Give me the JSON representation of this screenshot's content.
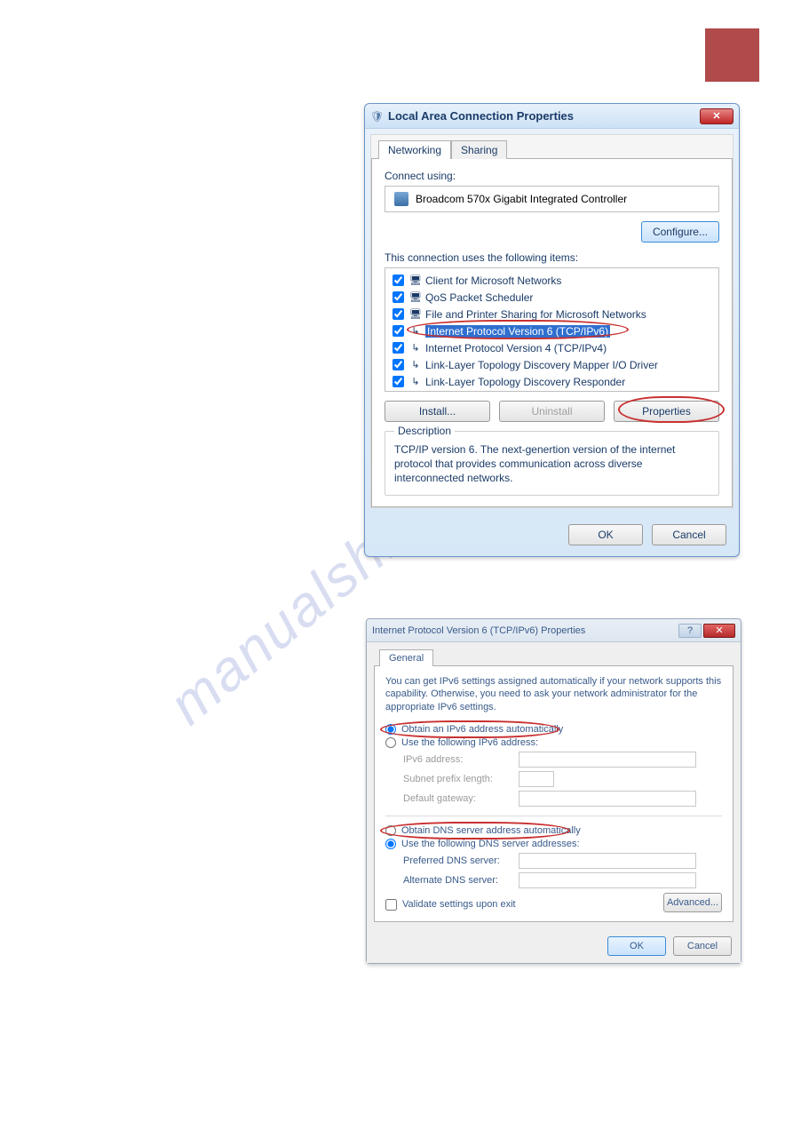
{
  "watermark": "manualshive.com",
  "dialog1": {
    "title": "Local Area Connection Properties",
    "tabs": {
      "networking": "Networking",
      "sharing": "Sharing"
    },
    "connect_using_label": "Connect using:",
    "adapter": "Broadcom 570x Gigabit Integrated Controller",
    "configure_btn": "Configure...",
    "items_label": "This connection uses the following items:",
    "items": [
      {
        "label": "Client for Microsoft Networks",
        "icon": "🖥"
      },
      {
        "label": "QoS Packet Scheduler",
        "icon": "🖥"
      },
      {
        "label": "File and Printer Sharing for Microsoft Networks",
        "icon": "🖥"
      },
      {
        "label": "Internet Protocol Version 6 (TCP/IPv6)",
        "icon": "↳",
        "selected": true
      },
      {
        "label": "Internet Protocol Version 4 (TCP/IPv4)",
        "icon": "↳"
      },
      {
        "label": "Link-Layer Topology Discovery Mapper I/O Driver",
        "icon": "↳"
      },
      {
        "label": "Link-Layer Topology Discovery Responder",
        "icon": "↳"
      }
    ],
    "install_btn": "Install...",
    "uninstall_btn": "Uninstall",
    "properties_btn": "Properties",
    "description_legend": "Description",
    "description_text": "TCP/IP version 6. The next-genertion version of the internet protocol that provides communication across diverse interconnected networks.",
    "ok_btn": "OK",
    "cancel_btn": "Cancel"
  },
  "dialog2": {
    "title": "Internet Protocol Version 6 (TCP/IPv6) Properties",
    "tab_general": "General",
    "intro": "You can get IPv6 settings assigned automatically if your network supports this capability. Otherwise, you need to ask your network administrator for the appropriate IPv6 settings.",
    "radio_auto_ip": "Obtain an IPv6 address automatically",
    "radio_manual_ip": "Use the following IPv6 address:",
    "lbl_ipv6_addr": "IPv6 address:",
    "lbl_prefix": "Subnet prefix length:",
    "lbl_gateway": "Default gateway:",
    "radio_auto_dns": "Obtain DNS server address automatically",
    "radio_manual_dns": "Use the following DNS server addresses:",
    "lbl_pref_dns": "Preferred DNS server:",
    "lbl_alt_dns": "Alternate DNS server:",
    "chk_validate": "Validate settings upon exit",
    "advanced_btn": "Advanced...",
    "ok_btn": "OK",
    "cancel_btn": "Cancel"
  }
}
